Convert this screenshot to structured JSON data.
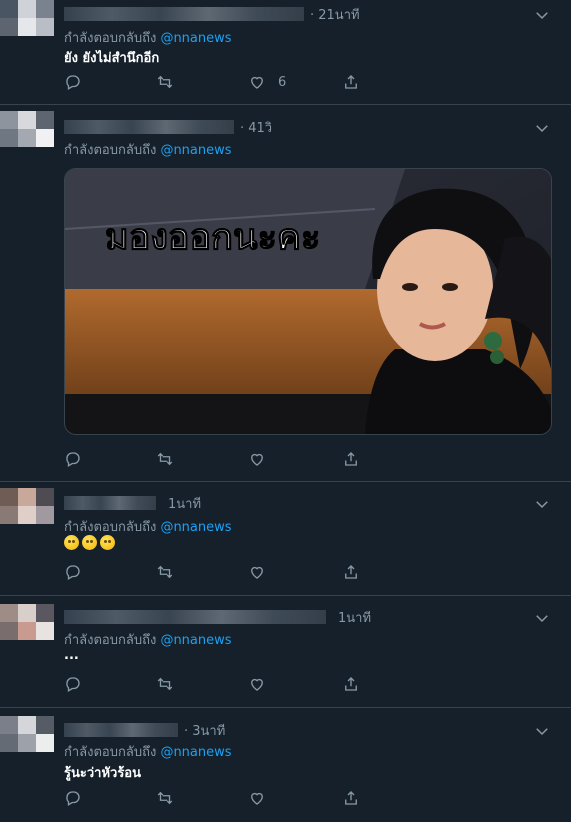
{
  "tweets": [
    {
      "time": "· 21นาที",
      "reply_prefix": "กำลังตอบกลับถึง",
      "reply_handle": "@nnanews",
      "text": "ยัง ยังไม่สำนึกอีก",
      "like_count": "6",
      "avatar_colors": [
        "#4a5563",
        "#cfd2d8",
        "#7a8290",
        "#e6e7ea",
        "#5d6670",
        "#b9bec6"
      ]
    },
    {
      "time": "· 41วิ",
      "reply_prefix": "กำลังตอบกลับถึง",
      "reply_handle": "@nnanews",
      "media_caption": "มองออกนะคะ",
      "avatar_colors": [
        "#8d949e",
        "#d7d9dd",
        "#5d6571",
        "#f1f1f3",
        "#a3a8b1",
        "#6f7782"
      ]
    },
    {
      "time": "1นาที",
      "reply_prefix": "กำลังตอบกลับถึง",
      "reply_handle": "@nnanews",
      "emoji_count": 3,
      "avatar_colors": [
        "#6f5c55",
        "#c7a89b",
        "#4e4c52",
        "#e0cfc8",
        "#8a7a76",
        "#a09aa0"
      ]
    },
    {
      "time": "1นาที",
      "reply_prefix": "กำลังตอบกลับถึง",
      "reply_handle": "@nnanews",
      "text": "...",
      "avatar_colors": [
        "#9e8c86",
        "#d8cfcb",
        "#5a5760",
        "#c89a90",
        "#e8e3e1",
        "#7a6d6d"
      ]
    },
    {
      "time": "· 3นาที",
      "reply_prefix": "กำลังตอบกลับถึง",
      "reply_handle": "@nnanews",
      "text": "รู้นะว่าหัวร้อน",
      "avatar_colors": [
        "#7a7f89",
        "#d4d6da",
        "#555c66",
        "#eceded",
        "#9da2aa",
        "#646b75"
      ]
    }
  ],
  "colors": {
    "background": "#15202b",
    "border": "#38444d",
    "muted": "#8899a6",
    "link": "#1da1f2"
  },
  "icons": [
    "reply-icon",
    "retweet-icon",
    "like-icon",
    "share-icon",
    "chevron-down-icon"
  ]
}
